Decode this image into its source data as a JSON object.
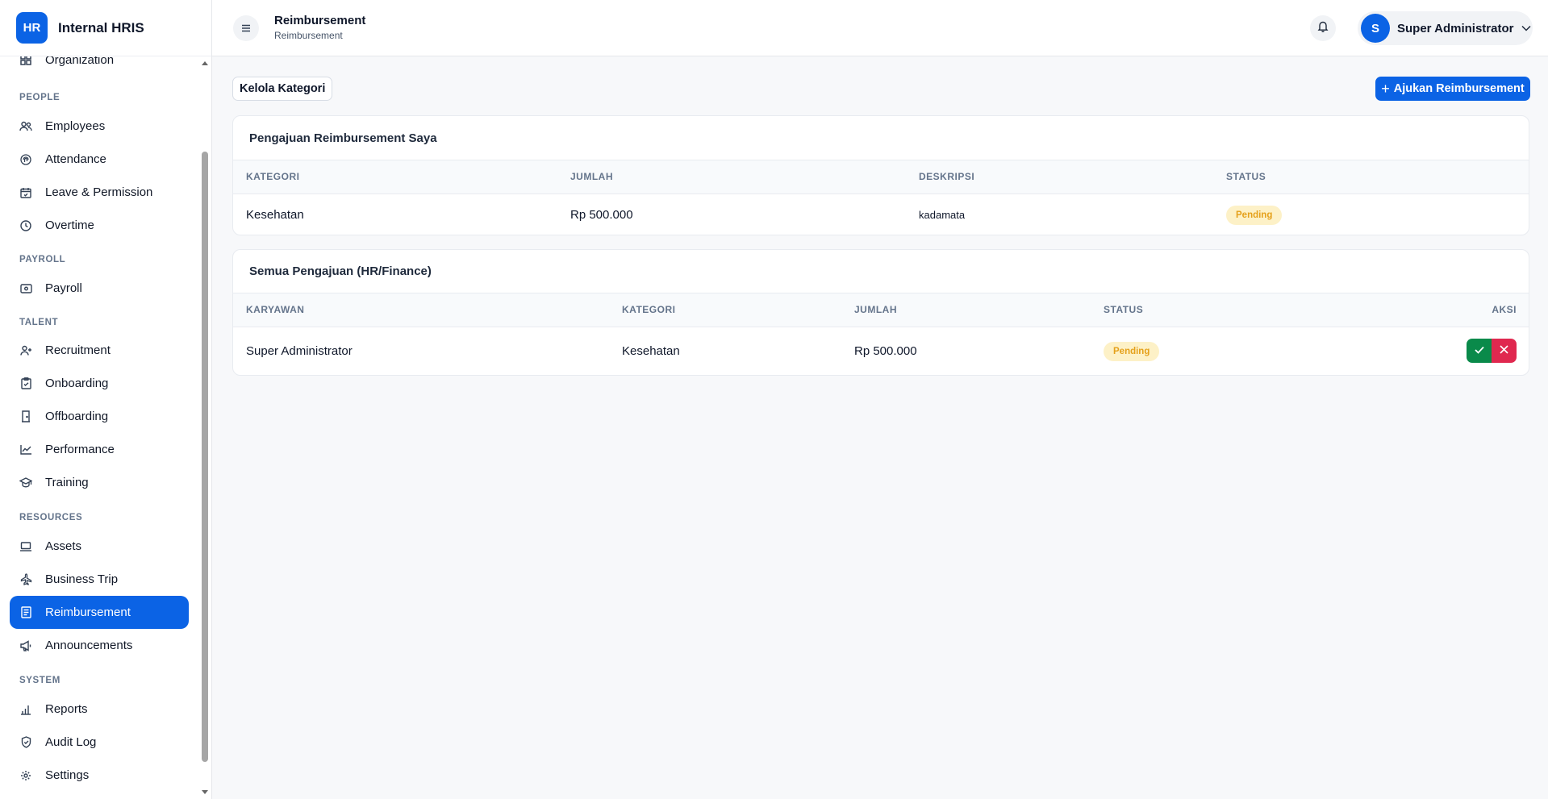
{
  "brand": {
    "logo": "HR",
    "name": "Internal HRIS"
  },
  "sidebar": {
    "partial_item": {
      "label": "Organization",
      "icon": "grid-icon"
    },
    "sections": [
      {
        "title": "PEOPLE",
        "items": [
          {
            "label": "Employees",
            "icon": "users-icon"
          },
          {
            "label": "Attendance",
            "icon": "fingerprint-icon"
          },
          {
            "label": "Leave & Permission",
            "icon": "calendar-icon"
          },
          {
            "label": "Overtime",
            "icon": "clock-icon"
          }
        ]
      },
      {
        "title": "PAYROLL",
        "items": [
          {
            "label": "Payroll",
            "icon": "wallet-icon"
          }
        ]
      },
      {
        "title": "TALENT",
        "items": [
          {
            "label": "Recruitment",
            "icon": "user-plus-icon"
          },
          {
            "label": "Onboarding",
            "icon": "clipboard-icon"
          },
          {
            "label": "Offboarding",
            "icon": "door-icon"
          },
          {
            "label": "Performance",
            "icon": "trend-icon"
          },
          {
            "label": "Training",
            "icon": "graduation-cap-icon"
          }
        ]
      },
      {
        "title": "RESOURCES",
        "items": [
          {
            "label": "Assets",
            "icon": "laptop-icon"
          },
          {
            "label": "Business Trip",
            "icon": "plane-icon"
          },
          {
            "label": "Reimbursement",
            "icon": "receipt-icon",
            "active": true
          },
          {
            "label": "Announcements",
            "icon": "megaphone-icon"
          }
        ]
      },
      {
        "title": "SYSTEM",
        "items": [
          {
            "label": "Reports",
            "icon": "bar-chart-icon"
          },
          {
            "label": "Audit Log",
            "icon": "shield-icon"
          },
          {
            "label": "Settings",
            "icon": "gear-icon"
          }
        ]
      }
    ]
  },
  "header": {
    "title": "Reimbursement",
    "subtitle": "Reimbursement",
    "user": {
      "initial": "S",
      "name": "Super Administrator"
    }
  },
  "toolbar": {
    "manage_categories": "Kelola Kategori",
    "submit_plus": "+",
    "submit": "Ajukan Reimbursement"
  },
  "my_requests": {
    "title": "Pengajuan Reimbursement Saya",
    "columns": [
      "KATEGORI",
      "JUMLAH",
      "DESKRIPSI",
      "STATUS"
    ],
    "rows": [
      {
        "kategori": "Kesehatan",
        "jumlah": "Rp 500.000",
        "deskripsi": "kadamata",
        "status": "Pending"
      }
    ]
  },
  "all_requests": {
    "title": "Semua Pengajuan (HR/Finance)",
    "columns": [
      "KARYAWAN",
      "KATEGORI",
      "JUMLAH",
      "STATUS",
      "AKSI"
    ],
    "rows": [
      {
        "karyawan": "Super Administrator",
        "kategori": "Kesehatan",
        "jumlah": "Rp 500.000",
        "status": "Pending"
      }
    ]
  },
  "colors": {
    "primary": "#0b63e5",
    "approve": "#0a8a4a",
    "reject": "#e0284f",
    "pending_bg": "#fdf1c7",
    "pending_text": "#e5a11b"
  }
}
